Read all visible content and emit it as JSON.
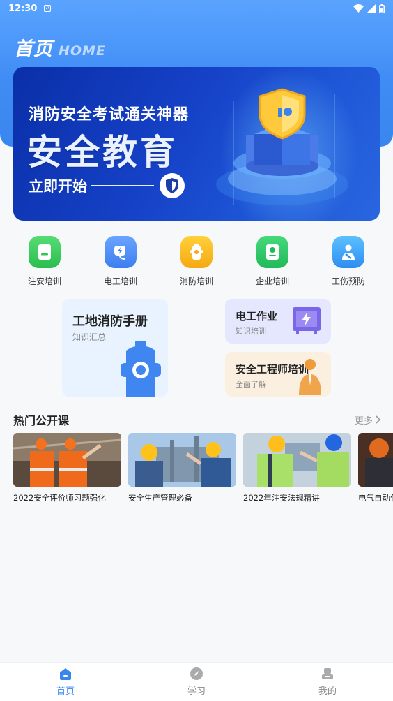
{
  "status_bar": {
    "time": "12:30",
    "notification_icon": "A"
  },
  "header": {
    "title": "首页",
    "subtitle": "HOME"
  },
  "banner": {
    "line1": "消防安全考试通关神器",
    "line2": "安全教育",
    "line3": "立即开始"
  },
  "nav": [
    {
      "label": "注安培训",
      "icon": "book-icon",
      "color": "#37c95a"
    },
    {
      "label": "电工培训",
      "icon": "plug-icon",
      "color": "#4d8cf5"
    },
    {
      "label": "消防培训",
      "icon": "hydrant-icon",
      "color": "#f5b41c"
    },
    {
      "label": "企业培训",
      "icon": "certificate-icon",
      "color": "#2fc46a"
    },
    {
      "label": "工伤预防",
      "icon": "injury-icon",
      "color": "#3fa6f5"
    }
  ],
  "cards": {
    "big": {
      "title": "工地消防手册",
      "subtitle": "知识汇总"
    },
    "electric": {
      "title": "电工作业",
      "subtitle": "知识培训"
    },
    "engineer": {
      "title": "安全工程师培训",
      "subtitle": "全面了解"
    }
  },
  "section": {
    "title": "热门公开课",
    "more": "更多"
  },
  "courses": [
    {
      "caption": "2022安全评价师习题强化"
    },
    {
      "caption": "安全生产管理必备"
    },
    {
      "caption": "2022年注安法规精讲"
    },
    {
      "caption": "电气自动化"
    }
  ],
  "tabs": [
    {
      "label": "首页",
      "icon": "home-icon",
      "active": true
    },
    {
      "label": "学习",
      "icon": "compass-icon",
      "active": false
    },
    {
      "label": "我的",
      "icon": "user-icon",
      "active": false
    }
  ]
}
